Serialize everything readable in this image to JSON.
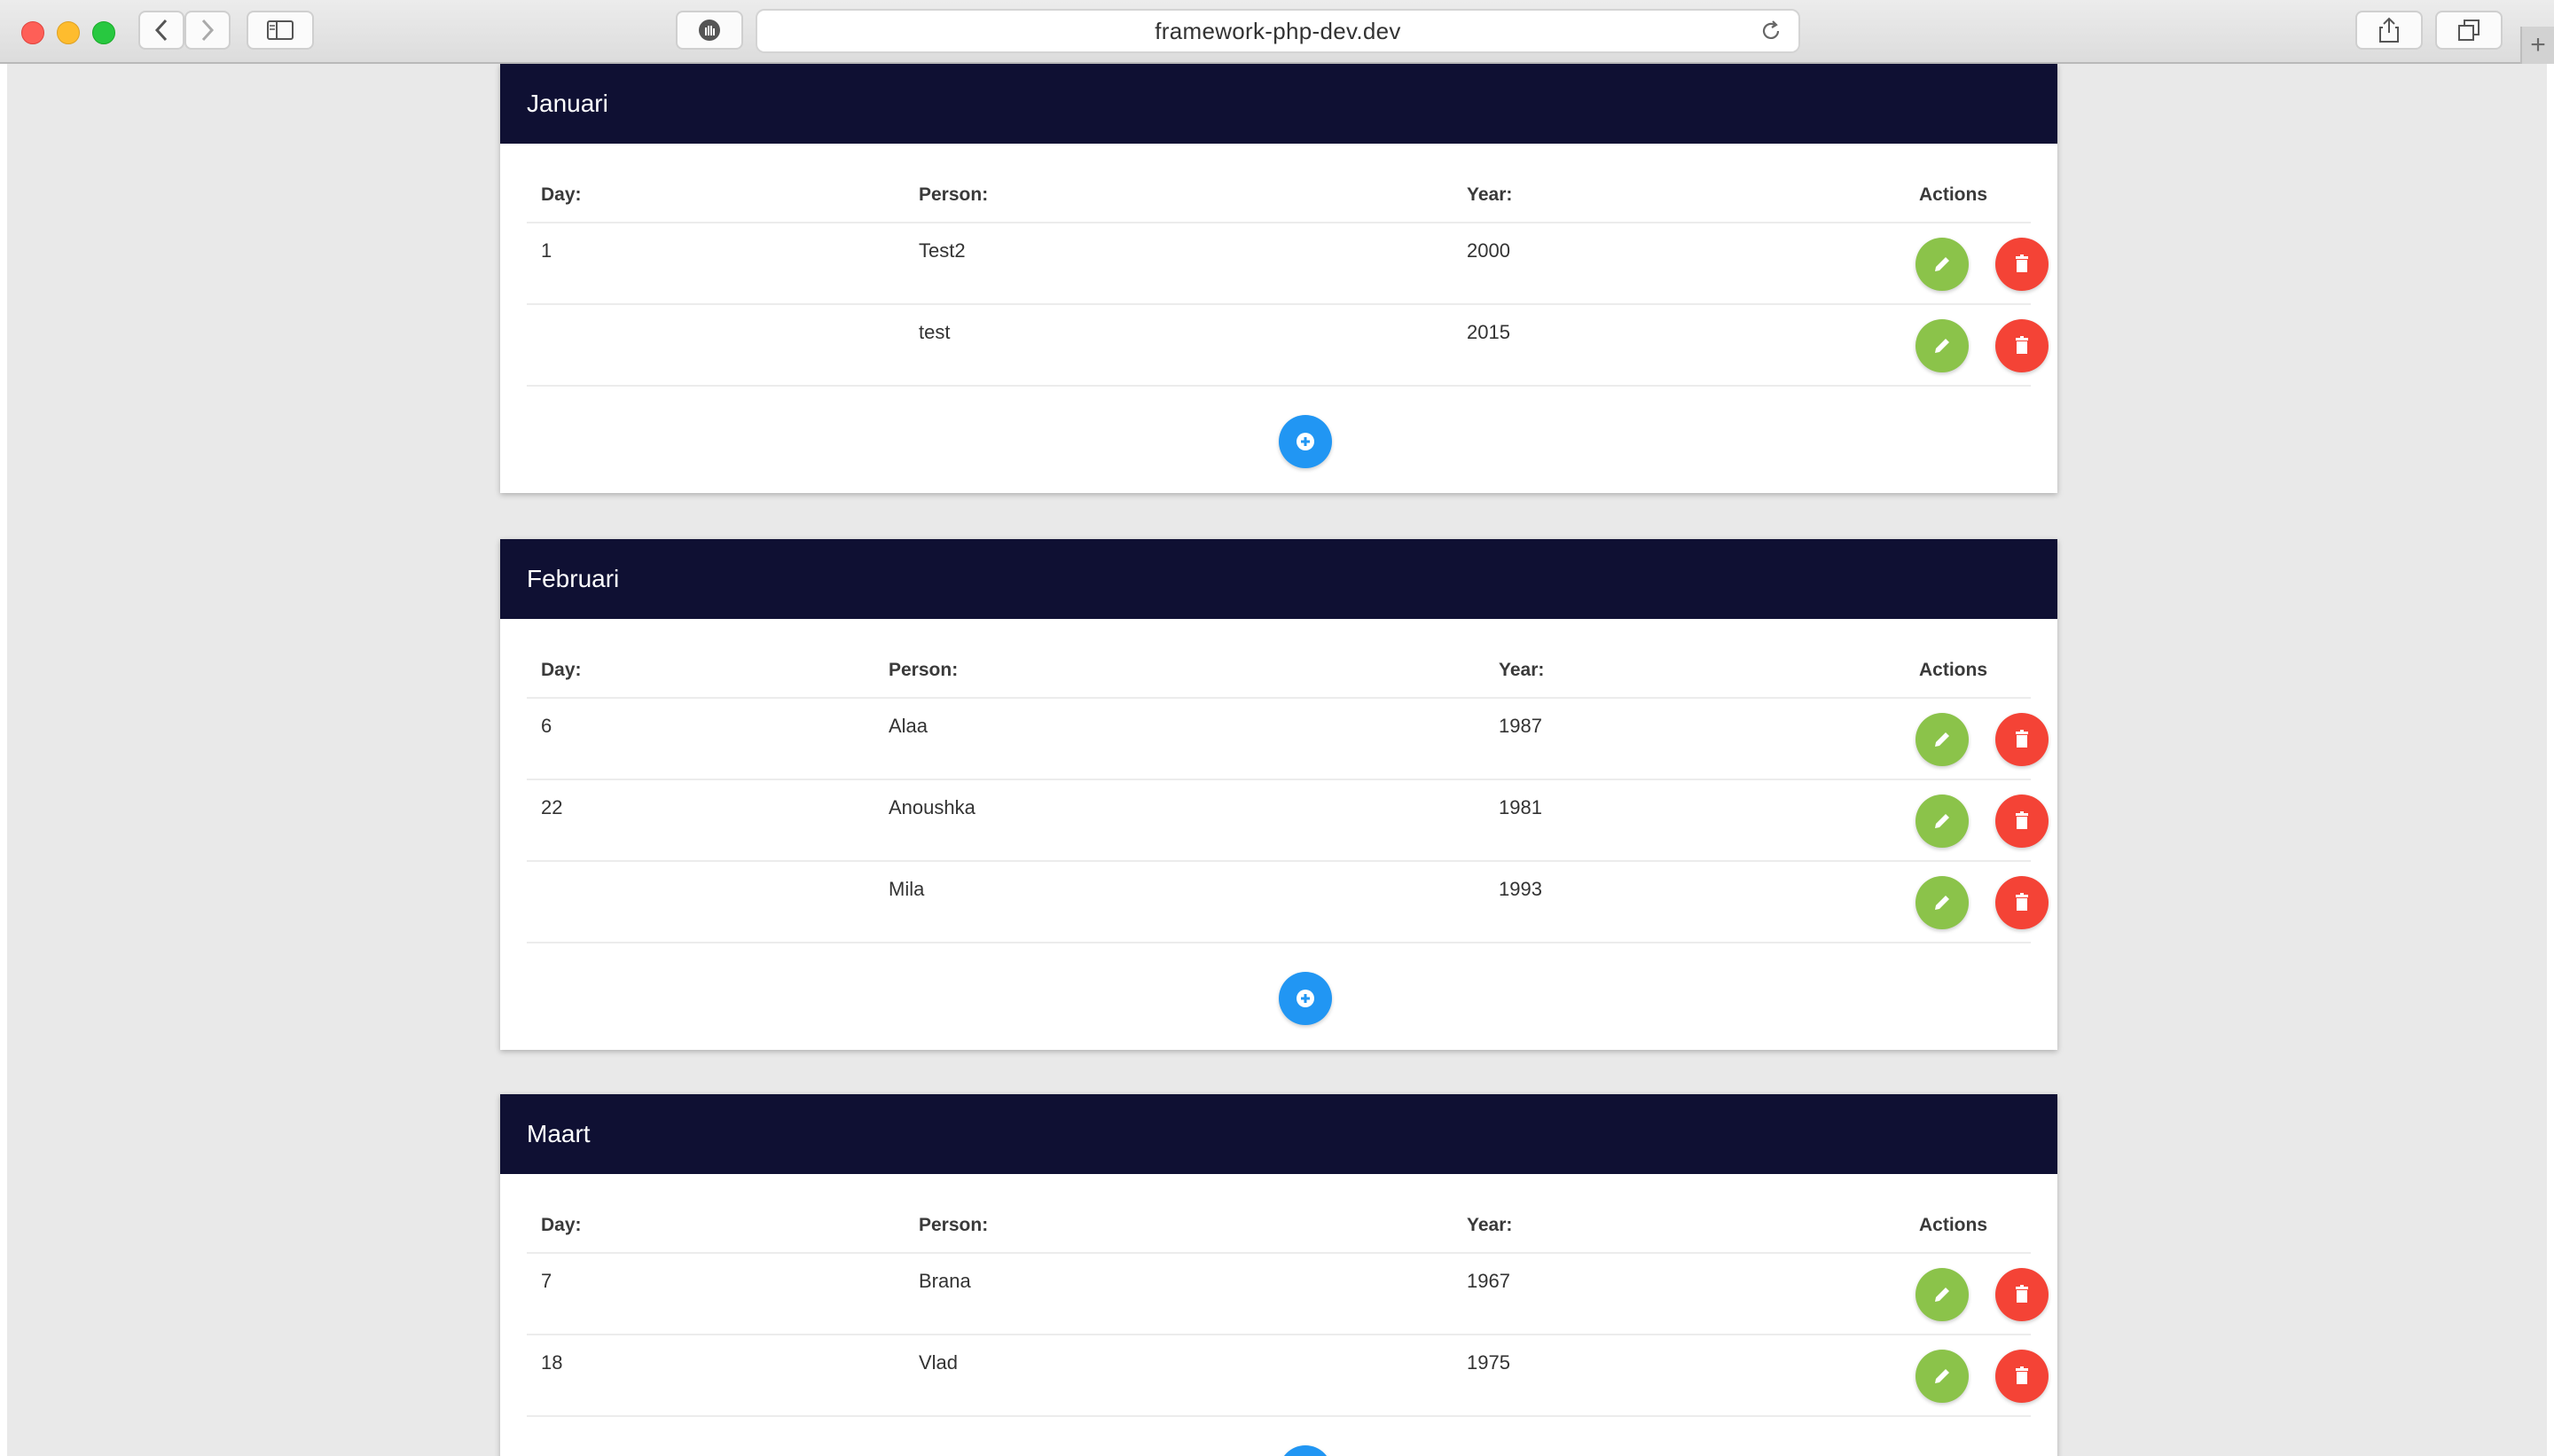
{
  "browser": {
    "url": "framework-php-dev.dev",
    "new_tab_label": "+"
  },
  "table_headers": {
    "day": "Day:",
    "person": "Person:",
    "year": "Year:",
    "actions": "Actions"
  },
  "months": [
    {
      "name": "Januari",
      "rows": [
        {
          "day": "1",
          "person": "Test2",
          "year": "2000"
        },
        {
          "day": "",
          "person": "test",
          "year": "2015"
        }
      ]
    },
    {
      "name": "Februari",
      "rows": [
        {
          "day": "6",
          "person": "Alaa",
          "year": "1987"
        },
        {
          "day": "22",
          "person": "Anoushka",
          "year": "1981"
        },
        {
          "day": "",
          "person": "Mila",
          "year": "1993"
        }
      ]
    },
    {
      "name": "Maart",
      "rows": [
        {
          "day": "7",
          "person": "Brana",
          "year": "1967"
        },
        {
          "day": "18",
          "person": "Vlad",
          "year": "1975"
        }
      ]
    }
  ],
  "icons": {
    "edit": "pencil-icon",
    "delete": "trash-icon",
    "add": "plus-circle-icon"
  },
  "colors": {
    "header_bg": "#0f1033",
    "edit": "#8bc34a",
    "delete": "#f44336",
    "add": "#2196f3"
  }
}
